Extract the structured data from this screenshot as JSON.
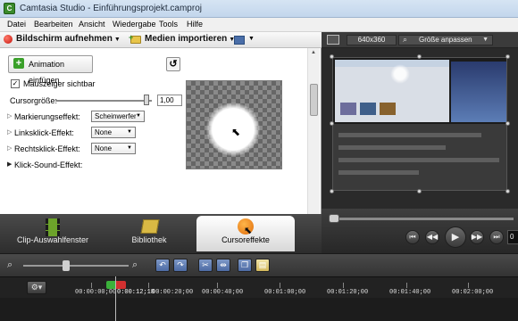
{
  "window": {
    "title": "Camtasia Studio - Einführungsprojekt.camproj",
    "app_icon": "C"
  },
  "menu": [
    "Datei",
    "Bearbeiten",
    "Ansicht",
    "Wiedergabe",
    "Tools",
    "Hilfe"
  ],
  "toolbar": {
    "record": "Bildschirm aufnehmen",
    "import": "Medien importieren"
  },
  "preview_toolbar": {
    "size": "640x360",
    "fit": "Größe anpassen"
  },
  "cursor_panel": {
    "add_animation": "Animation einfügen",
    "mouse_visible": "Mauszeiger sichtbar",
    "mouse_visible_checked": true,
    "cursor_size_label": "Cursorgröße:",
    "cursor_size_value": "1,00",
    "highlight_label": "Markierungseffekt:",
    "highlight_value": "Scheinwerfer",
    "left_click_label": "Linksklick-Effekt:",
    "left_click_value": "None",
    "right_click_label": "Rechtsklick-Effekt:",
    "right_click_value": "None",
    "click_sound_label": "Klick-Sound-Effekt:"
  },
  "tabs": [
    {
      "label": "Clip-Auswahlfenster",
      "icon": "film-icon",
      "active": false
    },
    {
      "label": "Bibliothek",
      "icon": "library-icon",
      "active": false
    },
    {
      "label": "Cursoreffekte",
      "icon": "cursor-effects-icon",
      "active": true
    }
  ],
  "player": {
    "time": "0"
  },
  "timeline": {
    "playhead_time": "0:00:12;18",
    "ticks": [
      "00:00:00;00",
      "00:00:20;00",
      "00:00:40;00",
      "00:01:00;00",
      "00:01:20;00",
      "00:01:40;00",
      "00:02:00;00"
    ]
  }
}
